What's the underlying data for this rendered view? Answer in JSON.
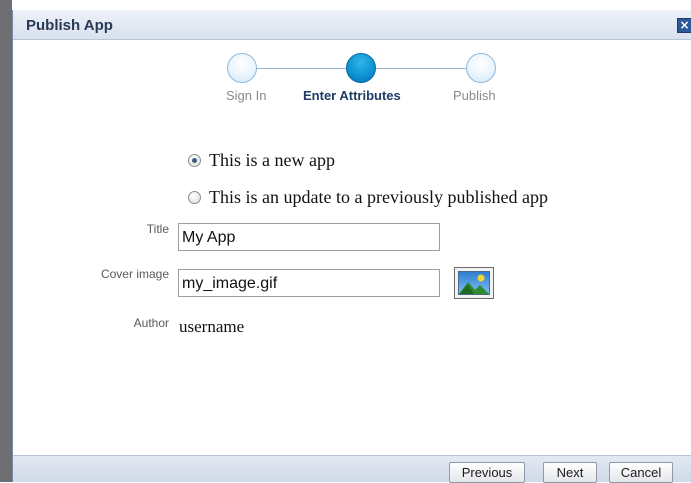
{
  "dialog": {
    "title": "Publish App",
    "close_glyph": "×"
  },
  "train": {
    "steps": [
      {
        "label": "Sign In",
        "state": "inactive"
      },
      {
        "label": "Enter Attributes",
        "state": "active"
      },
      {
        "label": "Publish",
        "state": "inactive"
      }
    ]
  },
  "form": {
    "radio_new": {
      "label": "This is a new app",
      "checked": true
    },
    "radio_update": {
      "label": "This is an update to a previously published app",
      "checked": false
    },
    "title": {
      "label": "Title",
      "value": "My App"
    },
    "cover_image": {
      "label": "Cover image",
      "value": "my_image.gif",
      "icon": "image-picker-icon"
    },
    "author": {
      "label": "Author",
      "value": "username"
    }
  },
  "footer": {
    "previous_label": "Previous",
    "next_label": "Next",
    "cancel_label": "Cancel"
  },
  "colors": {
    "accent": "#0d8fd0",
    "title_text": "#283a55",
    "active_step_text": "#1f3b63"
  }
}
